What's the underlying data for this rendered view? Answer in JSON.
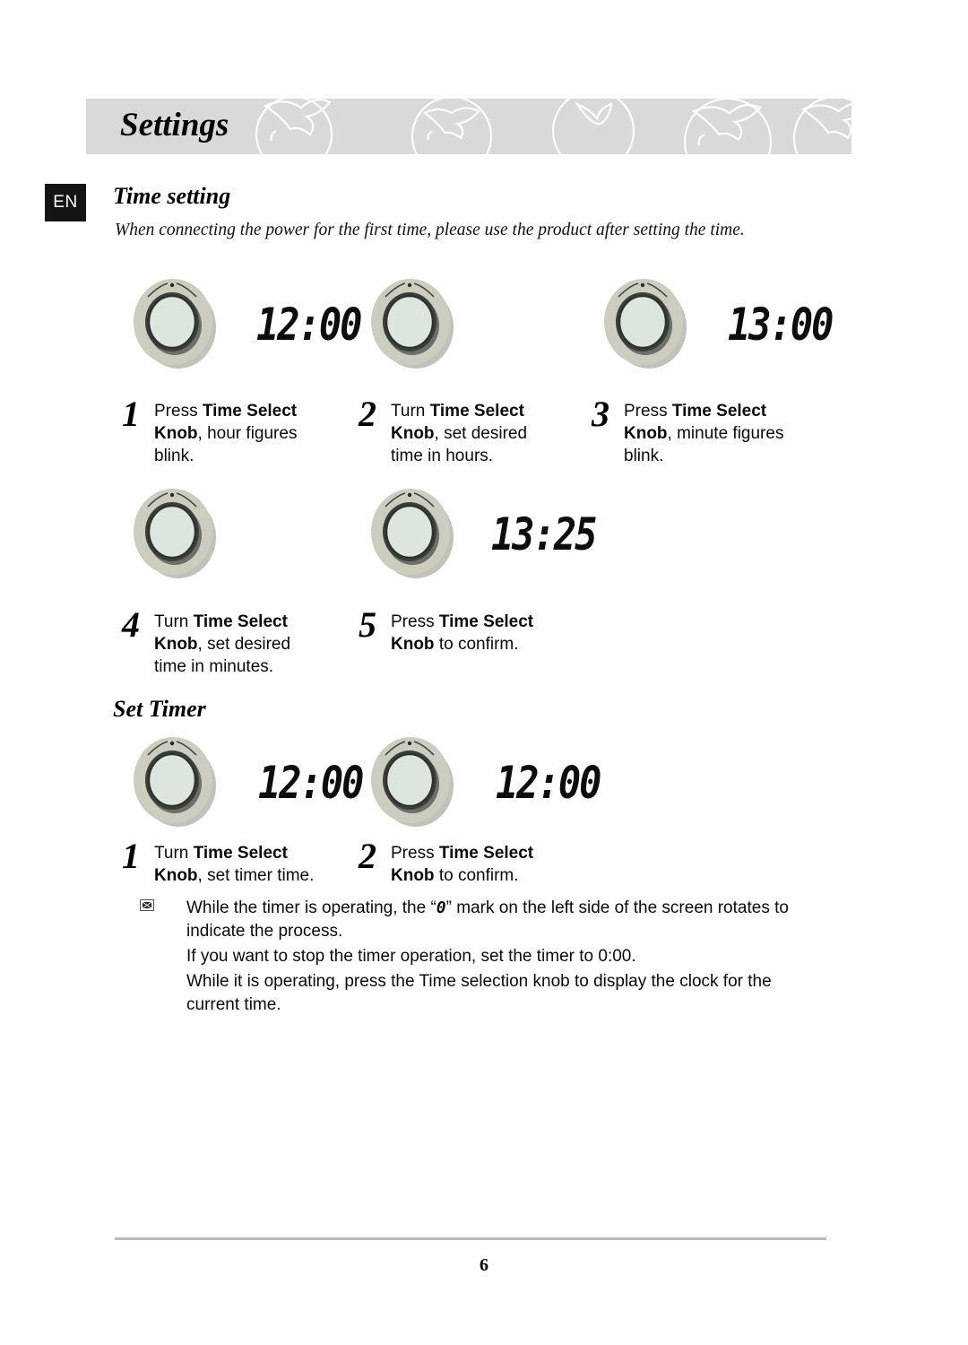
{
  "page": {
    "header_title": "Settings",
    "language_badge": "EN",
    "page_number": "6",
    "header_band_color": "#d9d9d9",
    "badge_color": "#141414"
  },
  "sections": [
    {
      "id": "time-setting",
      "heading": "Time setting",
      "intro": "When connecting the power for the first time, please use the product after setting the time.",
      "rows": [
        {
          "cells": [
            {
              "knob": "oven-control-knob",
              "display": "12:00"
            },
            {
              "knob": "oven-control-knob",
              "display": ""
            },
            {
              "knob": "oven-control-knob",
              "display": "13:00"
            }
          ]
        },
        {
          "cells": [
            {
              "knob": "oven-control-knob",
              "display": ""
            },
            {
              "knob": "oven-control-knob",
              "display": "13:25"
            }
          ]
        }
      ],
      "steps": [
        {
          "num": "1",
          "action": "Press ",
          "bold1": "Time Select",
          "line2_bold": "Knob",
          "line2_rest": ", hour figures",
          "line3": "blink."
        },
        {
          "num": "2",
          "action": "Turn ",
          "bold1": "Time Select",
          "line2_bold": "Knob",
          "line2_rest": ", set desired",
          "line3": "time in hours."
        },
        {
          "num": "3",
          "action": "Press ",
          "bold1": "Time Select",
          "line2_bold": "Knob",
          "line2_rest": ", minute figures",
          "line3": "blink."
        },
        {
          "num": "4",
          "action": "Turn ",
          "bold1": "Time Select",
          "line2_bold": "Knob",
          "line2_rest": ", set desired",
          "line3": "time in minutes."
        },
        {
          "num": "5",
          "action": "Press ",
          "bold1": "Time Select",
          "line2_bold": "Knob",
          "line2_rest": " to confirm.",
          "line3": ""
        }
      ]
    },
    {
      "id": "set-timer",
      "heading": "Set Timer",
      "rows": [
        {
          "cells": [
            {
              "knob": "oven-control-knob",
              "display": "12:00"
            },
            {
              "knob": "oven-control-knob",
              "display": "12:00"
            }
          ]
        }
      ],
      "steps": [
        {
          "num": "1",
          "action": "Turn ",
          "bold1": "Time Select",
          "line2_bold": "Knob",
          "line2_rest": ", set timer time.",
          "line3": ""
        },
        {
          "num": "2",
          "action": "Press ",
          "bold1": "Time Select",
          "line2_bold": "Knob",
          "line2_rest": " to confirm.",
          "line3": ""
        }
      ],
      "notes": {
        "icon": "note-marker-icon",
        "paragraphs": [
          {
            "pre": "While the timer is operating, the “",
            "lcd": "0",
            "post": "” mark on the left side of the screen rotates to indicate the process."
          },
          {
            "pre": "If you want to stop the timer operation, set the timer to 0:00.",
            "lcd": "",
            "post": ""
          },
          {
            "pre": "While it is operating, press the Time selection knob to display the clock for the current time.",
            "lcd": "",
            "post": ""
          }
        ]
      }
    }
  ]
}
